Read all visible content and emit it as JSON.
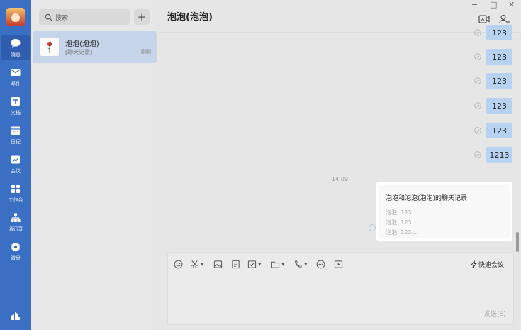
{
  "nav": {
    "items": [
      {
        "label": "消息",
        "icon": "chat-bubble-icon",
        "active": true
      },
      {
        "label": "邮件",
        "icon": "mail-icon"
      },
      {
        "label": "文档",
        "icon": "document-icon"
      },
      {
        "label": "日程",
        "icon": "calendar-icon"
      },
      {
        "label": "会议",
        "icon": "meeting-icon"
      },
      {
        "label": "工作台",
        "icon": "workbench-grid-icon"
      },
      {
        "label": "通讯录",
        "icon": "contacts-tree-icon"
      },
      {
        "label": "微盘",
        "icon": "cloud-disk-icon"
      }
    ],
    "bottom_icon": "org-chart-icon"
  },
  "list": {
    "search_placeholder": "搜索",
    "add_label": "+",
    "conversation": {
      "name": "泡泡(泡泡)",
      "preview": "[聊天记录]",
      "time": "刚刚"
    }
  },
  "chat": {
    "title": "泡泡(泡泡)",
    "window_controls": [
      "−",
      "□",
      "✕"
    ],
    "messages": [
      "123",
      "123",
      "123",
      "123",
      "123",
      "1213"
    ],
    "time_separator": "14:09",
    "card": {
      "title": "泡泡和泡泡(泡泡)的聊天记录",
      "lines": [
        "泡泡: 123",
        "泡泡: 123",
        "泡泡: 123..."
      ]
    }
  },
  "composer": {
    "quick_meeting": "快速会议",
    "send": "发送(S)"
  },
  "colors": {
    "rail": "#3a6fc4",
    "bubble": "#b7d3f1",
    "selected_conversation": "#c6d5ea"
  }
}
